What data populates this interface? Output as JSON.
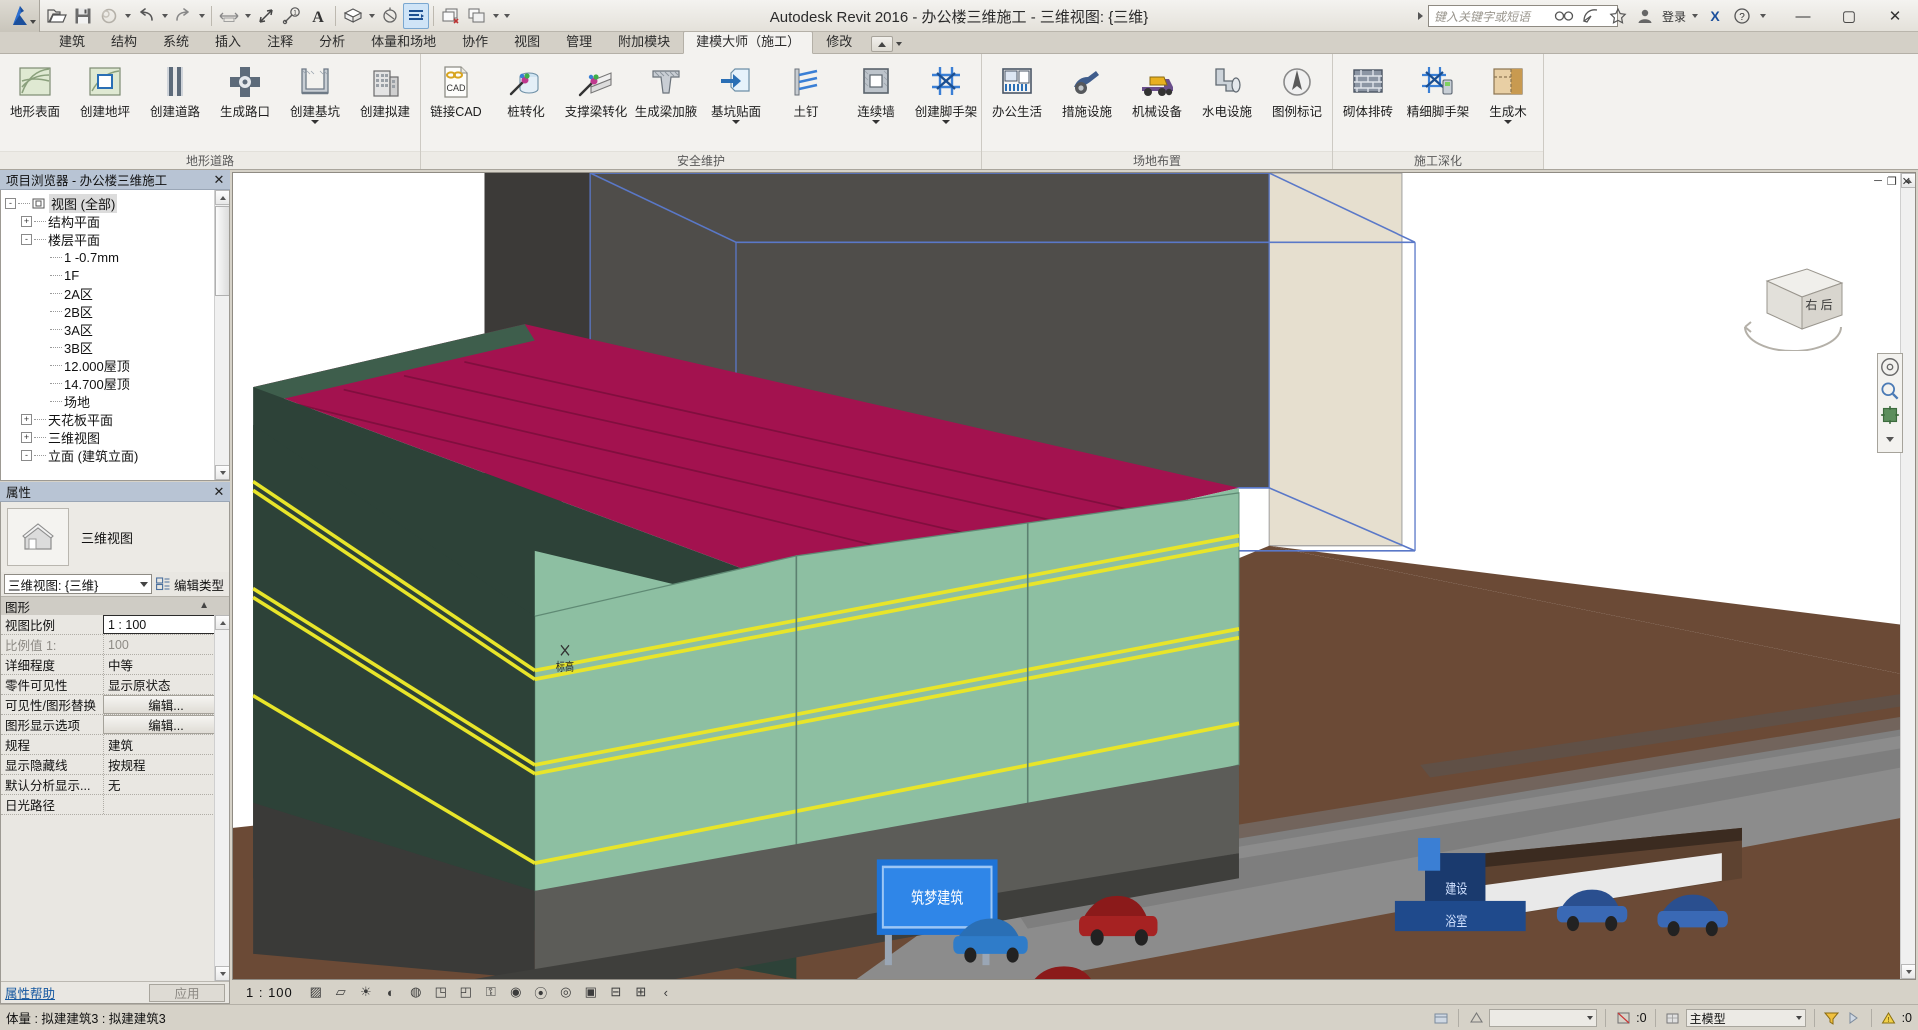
{
  "titlebar": {
    "app_title": "Autodesk Revit 2016 -   办公楼三维施工 - 三维视图: {三维}",
    "search_placeholder": "键入关键字或短语",
    "signin_label": "登录",
    "quick_access": [
      {
        "name": "open-icon",
        "label": "打开"
      },
      {
        "name": "save-icon",
        "label": "保存"
      },
      {
        "name": "sync-icon",
        "label": "与中心文件同步"
      },
      {
        "name": "undo-icon",
        "label": "放弃"
      },
      {
        "name": "redo-icon",
        "label": "重做"
      },
      {
        "name": "measure-icon",
        "label": "测量"
      },
      {
        "name": "aligned-dimension-icon",
        "label": "对齐尺寸标注"
      },
      {
        "name": "tag-icon",
        "label": "按类别标记"
      },
      {
        "name": "text-icon",
        "label": "文字"
      },
      {
        "name": "default-3d-view-icon",
        "label": "默认三维视图"
      },
      {
        "name": "section-icon",
        "label": "剖面"
      },
      {
        "name": "thin-lines-icon",
        "label": "细线"
      },
      {
        "name": "close-hidden-windows-icon",
        "label": "关闭隐藏窗口"
      },
      {
        "name": "switch-windows-icon",
        "label": "切换窗口"
      }
    ],
    "tray": [
      "search-icon",
      "subscription-icon",
      "favorites-icon",
      "account-icon"
    ],
    "window_controls": {
      "minimize": "—",
      "maximize": "▢",
      "close": "✕"
    }
  },
  "tabs": [
    {
      "label": "建筑",
      "active": false
    },
    {
      "label": "结构",
      "active": false
    },
    {
      "label": "系统",
      "active": false
    },
    {
      "label": "插入",
      "active": false
    },
    {
      "label": "注释",
      "active": false
    },
    {
      "label": "分析",
      "active": false
    },
    {
      "label": "体量和场地",
      "active": false
    },
    {
      "label": "协作",
      "active": false
    },
    {
      "label": "视图",
      "active": false
    },
    {
      "label": "管理",
      "active": false
    },
    {
      "label": "附加模块",
      "active": false
    },
    {
      "label": "建模大师（施工）",
      "active": true
    },
    {
      "label": "修改",
      "active": false
    }
  ],
  "ribbon": {
    "panels": [
      {
        "title": "地形道路",
        "buttons": [
          {
            "label": "地形表面",
            "icon": "terrain-surface-icon",
            "dropdown": false
          },
          {
            "label": "创建地坪",
            "icon": "create-pad-icon",
            "dropdown": false
          },
          {
            "label": "创建道路",
            "icon": "create-road-icon",
            "dropdown": false
          },
          {
            "label": "生成路口",
            "icon": "generate-junction-icon",
            "dropdown": false
          },
          {
            "label": "创建基坑",
            "icon": "create-pit-icon",
            "dropdown": true
          },
          {
            "label": "创建拟建",
            "icon": "create-proposed-building-icon",
            "dropdown": false
          }
        ]
      },
      {
        "title": "安全维护",
        "buttons": [
          {
            "label": "链接CAD",
            "icon": "link-cad-icon",
            "dropdown": false
          },
          {
            "label": "桩转化",
            "icon": "pile-convert-icon",
            "dropdown": false
          },
          {
            "label": "支撑梁转化",
            "icon": "brace-beam-convert-icon",
            "dropdown": false
          },
          {
            "label": "生成梁加腋",
            "icon": "beam-haunch-icon",
            "dropdown": false
          },
          {
            "label": "基坑贴面",
            "icon": "pit-facing-icon",
            "dropdown": true
          },
          {
            "label": "土钉",
            "icon": "soil-nail-icon",
            "dropdown": false
          },
          {
            "label": "连续墙",
            "icon": "diaphragm-wall-icon",
            "dropdown": true
          },
          {
            "label": "创建脚手架",
            "icon": "create-scaffold-icon",
            "dropdown": true
          }
        ]
      },
      {
        "title": "场地布置",
        "buttons": [
          {
            "label": "办公生活",
            "icon": "office-life-icon",
            "dropdown": false
          },
          {
            "label": "措施设施",
            "icon": "measure-facility-icon",
            "dropdown": false
          },
          {
            "label": "机械设备",
            "icon": "machinery-icon",
            "dropdown": false
          },
          {
            "label": "水电设施",
            "icon": "water-power-icon",
            "dropdown": false
          },
          {
            "label": "图例标记",
            "icon": "legend-mark-icon",
            "dropdown": false
          }
        ]
      },
      {
        "title": "施工深化",
        "buttons": [
          {
            "label": "砌体排砖",
            "icon": "masonry-layout-icon",
            "dropdown": false
          },
          {
            "label": "精细脚手架",
            "icon": "fine-scaffold-icon",
            "dropdown": false
          },
          {
            "label": "生成木",
            "icon": "generate-formwork-icon",
            "dropdown": true
          }
        ]
      }
    ]
  },
  "browser": {
    "title": "项目浏览器 - 办公楼三维施工",
    "close_label": "✕",
    "tree": [
      {
        "label": "视图 (全部)",
        "depth": 0,
        "toggle": "-",
        "selected": true,
        "icon": "views-icon"
      },
      {
        "label": "结构平面",
        "depth": 1,
        "toggle": "+",
        "selected": false,
        "icon": ""
      },
      {
        "label": "楼层平面",
        "depth": 1,
        "toggle": "-",
        "selected": false,
        "icon": ""
      },
      {
        "label": "1 -0.7mm",
        "depth": 2,
        "toggle": "",
        "selected": false,
        "icon": ""
      },
      {
        "label": "1F",
        "depth": 2,
        "toggle": "",
        "selected": false,
        "icon": ""
      },
      {
        "label": "2A区",
        "depth": 2,
        "toggle": "",
        "selected": false,
        "icon": ""
      },
      {
        "label": "2B区",
        "depth": 2,
        "toggle": "",
        "selected": false,
        "icon": ""
      },
      {
        "label": "3A区",
        "depth": 2,
        "toggle": "",
        "selected": false,
        "icon": ""
      },
      {
        "label": "3B区",
        "depth": 2,
        "toggle": "",
        "selected": false,
        "icon": ""
      },
      {
        "label": "12.000屋顶",
        "depth": 2,
        "toggle": "",
        "selected": false,
        "icon": ""
      },
      {
        "label": "14.700屋顶",
        "depth": 2,
        "toggle": "",
        "selected": false,
        "icon": ""
      },
      {
        "label": "场地",
        "depth": 2,
        "toggle": "",
        "selected": false,
        "icon": ""
      },
      {
        "label": "天花板平面",
        "depth": 1,
        "toggle": "+",
        "selected": false,
        "icon": ""
      },
      {
        "label": "三维视图",
        "depth": 1,
        "toggle": "+",
        "selected": false,
        "icon": ""
      },
      {
        "label": "立面 (建筑立面)",
        "depth": 1,
        "toggle": "-",
        "selected": false,
        "icon": ""
      }
    ]
  },
  "properties": {
    "title": "属性",
    "close_label": "✕",
    "preview_label": "三维视图",
    "type_selector": "三维视图: {三维}",
    "edit_type_label": "编辑类型",
    "group_label": "图形",
    "rows": [
      {
        "key": "视图比例",
        "value": "1 : 100",
        "kind": "boxed"
      },
      {
        "key": "比例值 1:",
        "value": "100",
        "kind": "dim"
      },
      {
        "key": "详细程度",
        "value": "中等",
        "kind": "text"
      },
      {
        "key": "零件可见性",
        "value": "显示原状态",
        "kind": "text"
      },
      {
        "key": "可见性/图形替换",
        "value": "编辑...",
        "kind": "button"
      },
      {
        "key": "图形显示选项",
        "value": "编辑...",
        "kind": "button"
      },
      {
        "key": "规程",
        "value": "建筑",
        "kind": "text"
      },
      {
        "key": "显示隐藏线",
        "value": "按规程",
        "kind": "text"
      },
      {
        "key": "默认分析显示...",
        "value": "无",
        "kind": "text"
      },
      {
        "key": "日光路径",
        "value": "",
        "kind": "text"
      }
    ],
    "help_link": "属性帮助",
    "apply_label": "应用"
  },
  "viewport": {
    "viewcube_label": "右 后",
    "window_controls": [
      "minimize-icon",
      "restore-icon",
      "close-icon"
    ],
    "navbar_icons": [
      "steering-wheel-icon",
      "zoom-icon",
      "pan-icon",
      "navbar-caret-icon"
    ]
  },
  "viewbar": {
    "scale": "1 : 100",
    "icons": [
      "detail-level-icon",
      "visual-style-icon",
      "sun-path-icon",
      "shadows-icon",
      "rendering-dialog-icon",
      "crop-view-icon",
      "show-crop-region-icon",
      "lock-3d-view-icon",
      "temporary-hide-isolate-icon",
      "reveal-hidden-elements-icon",
      "worksharing-display-icon",
      "temporary-view-properties-icon",
      "show-constraints-icon",
      "analytical-model-icon",
      "expand-icon"
    ]
  },
  "statusbar": {
    "message": "体量 : 拟建建筑3 : 拟建建筑3",
    "press_select_count": ":0",
    "model_label": "主模型",
    "filter_count": ":0",
    "right_icons": [
      "worksets-icon",
      "design-options-icon",
      "exclude-options-icon",
      "filter-icon",
      "warnings-icon"
    ]
  },
  "colors": {
    "ribbon_bg": "#f3f2ef",
    "chrome_bg": "#d6d2c8",
    "panel_header": "#b8c4d4",
    "accent_blue": "#1457a0",
    "roof_magenta": "#a3124f",
    "wall_green": "#8dbfa2",
    "wall_dark": "#2d4238",
    "ground_brown": "#6b4a36",
    "sky_gray": "#4f4d4a"
  }
}
